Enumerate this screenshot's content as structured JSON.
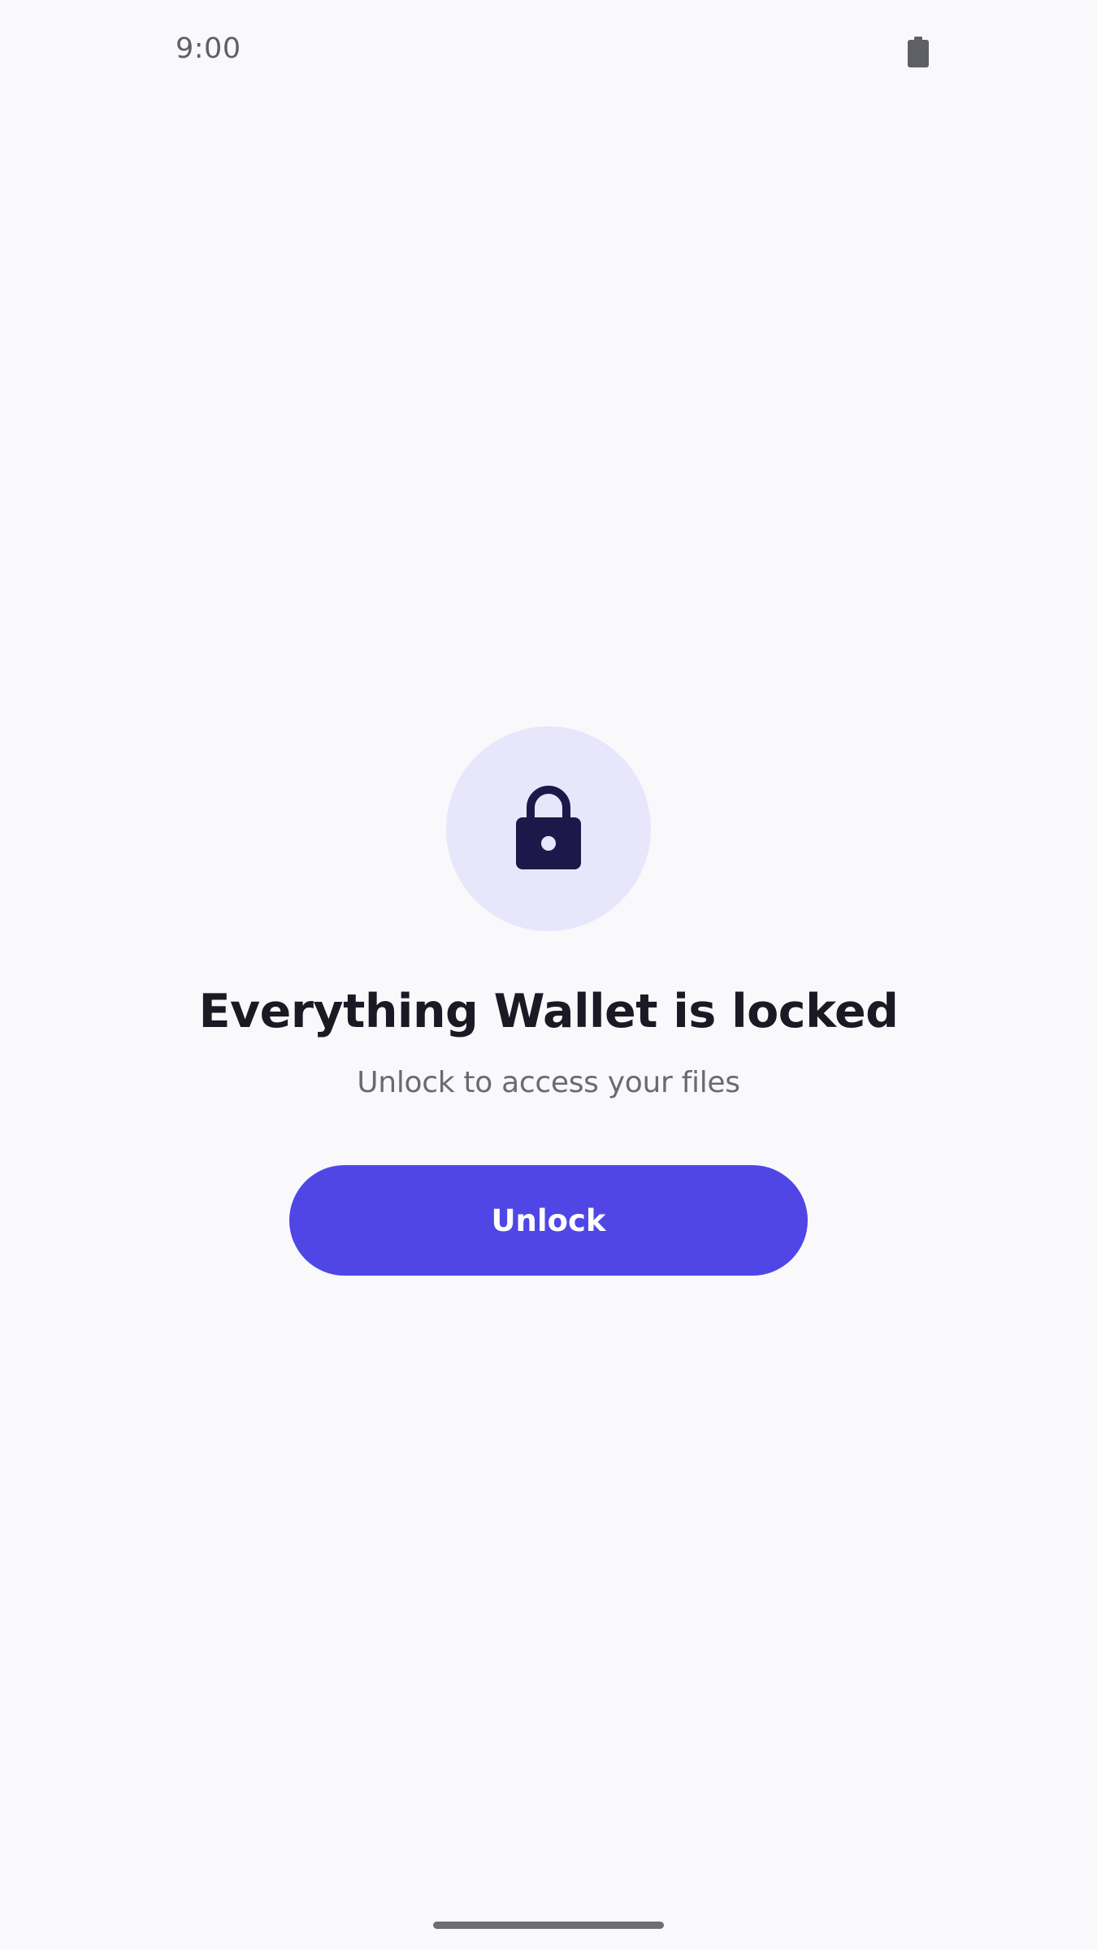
{
  "status_bar": {
    "time": "9:00",
    "battery_icon": "battery-full-icon"
  },
  "lock_screen": {
    "icon": "lock-icon",
    "title": "Everything Wallet is locked",
    "subtitle": "Unlock to access your files",
    "unlock_label": "Unlock"
  },
  "colors": {
    "background": "#f9f9fc",
    "accent": "#5046e6",
    "icon_circle": "#e8e6fb",
    "icon": "#1c1849",
    "title_text": "#1b1a24",
    "subtitle_text": "#6b6a73"
  }
}
